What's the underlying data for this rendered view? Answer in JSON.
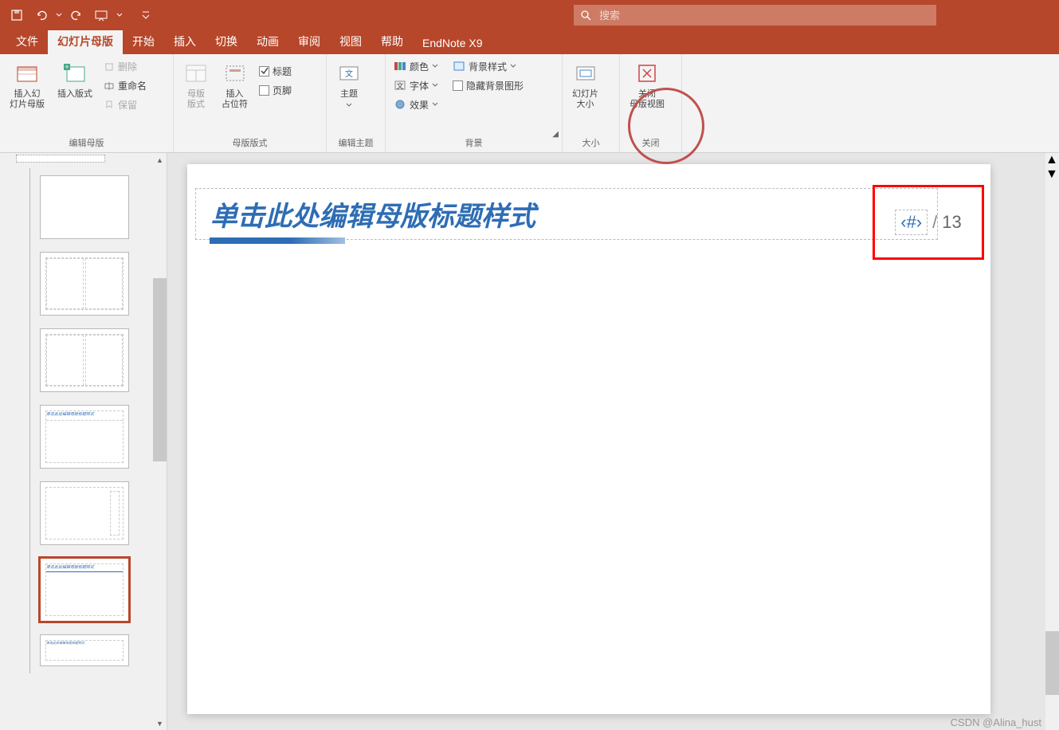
{
  "qat": {
    "save": "保存",
    "undo": "撤销",
    "redo": "重做",
    "slideshow": "从头开始",
    "more": "更多"
  },
  "search": {
    "placeholder": "搜索"
  },
  "tabs": [
    "文件",
    "幻灯片母版",
    "开始",
    "插入",
    "切换",
    "动画",
    "审阅",
    "视图",
    "帮助",
    "EndNote X9"
  ],
  "activeTab": 1,
  "ribbon": {
    "editMaster": {
      "label": "编辑母版",
      "insertSlideMaster": "插入幻\n灯片母版",
      "insertLayout": "插入版式",
      "delete": "删除",
      "rename": "重命名",
      "preserve": "保留"
    },
    "masterLayout": {
      "label": "母版版式",
      "masterLayout": "母版\n版式",
      "insertPlaceholder": "插入\n占位符",
      "title": "标题",
      "footer": "页脚"
    },
    "editTheme": {
      "label": "编辑主题",
      "theme": "主题"
    },
    "background": {
      "label": "背景",
      "colors": "颜色",
      "fonts": "字体",
      "effects": "效果",
      "bgStyles": "背景样式",
      "hideBg": "隐藏背景图形"
    },
    "size": {
      "label": "大小",
      "slideSize": "幻灯片\n大小"
    },
    "close": {
      "label": "关闭",
      "closeMaster": "关闭\n母版视图"
    }
  },
  "slide": {
    "titlePlaceholder": "单击此处编辑母版标题样式",
    "pageNumPlaceholder": "‹#›",
    "separator": "/",
    "totalPages": "13"
  },
  "watermark": "CSDN @Alina_hust"
}
